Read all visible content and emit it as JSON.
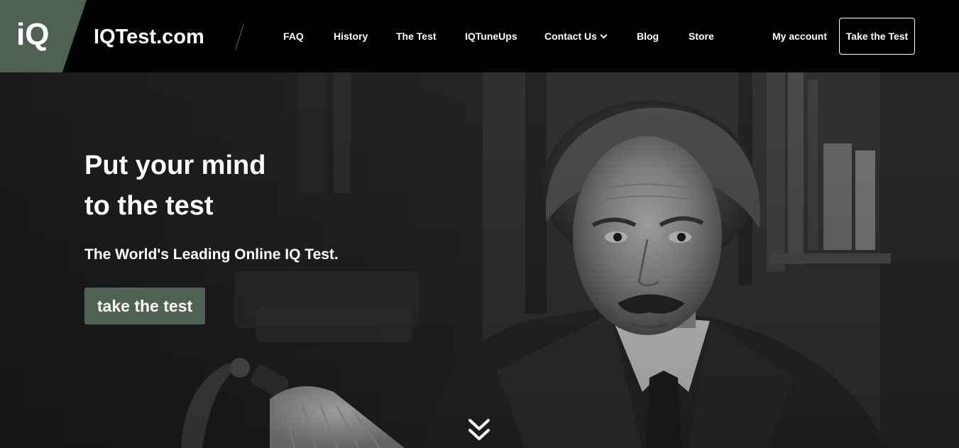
{
  "header": {
    "logo_text": "iQ",
    "brand": "IQTest.com",
    "nav": [
      {
        "label": "FAQ"
      },
      {
        "label": "History"
      },
      {
        "label": "The Test"
      },
      {
        "label": "IQTuneUps"
      },
      {
        "label": "Contact Us",
        "has_dropdown": true
      },
      {
        "label": "Blog"
      },
      {
        "label": "Store"
      }
    ],
    "account_label": "My account",
    "cta_label": "Take the Test"
  },
  "hero": {
    "title_line1": "Put your mind",
    "title_line2": "to the test",
    "subtitle": "The World's Leading Online IQ Test.",
    "cta_label": "take the test",
    "scroll_icon": "double-chevron-down-icon"
  },
  "colors": {
    "accent": "#4f6252",
    "header_bg": "#000000",
    "hero_bg": "#262626",
    "text": "#ffffff"
  }
}
